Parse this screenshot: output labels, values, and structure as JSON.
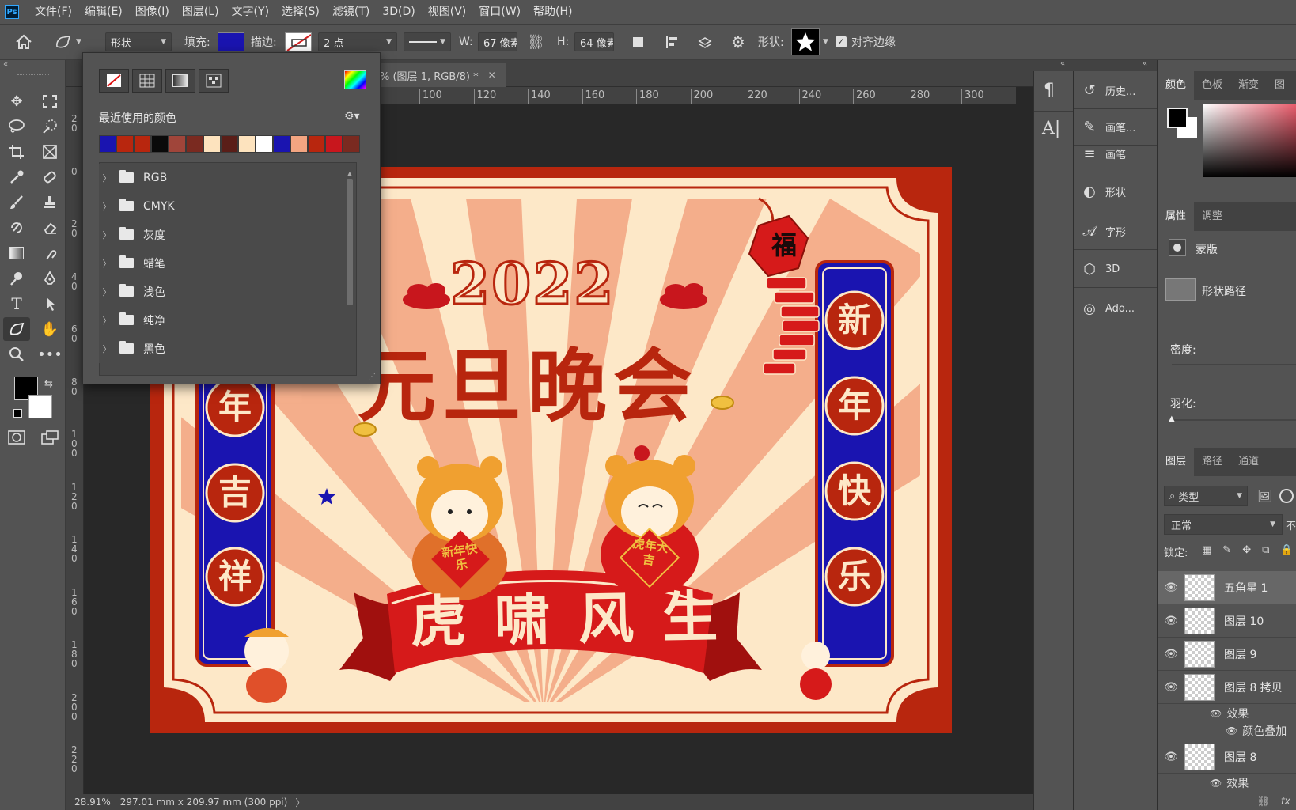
{
  "app": {
    "logo": "Ps"
  },
  "menu": [
    "文件(F)",
    "编辑(E)",
    "图像(I)",
    "图层(L)",
    "文字(Y)",
    "选择(S)",
    "滤镜(T)",
    "3D(D)",
    "视图(V)",
    "窗口(W)",
    "帮助(H)"
  ],
  "options": {
    "mode": "形状",
    "fill_label": "填充:",
    "fill_color": "#1a14b0",
    "stroke_label": "描边:",
    "stroke_width": "2 点",
    "w_label": "W:",
    "w_value": "67 像素",
    "h_label": "H:",
    "h_value": "64 像素",
    "shape_label": "形状:",
    "align_edges": "对齐边缘"
  },
  "document": {
    "tab_title": "% (图层 1, RGB/8) *",
    "zoom": "28.91%",
    "doc_info": "297.01 mm x 209.97 mm (300 ppi)"
  },
  "rulers": {
    "top": [
      "100",
      "120",
      "140",
      "160",
      "180",
      "200",
      "220",
      "240",
      "260",
      "280",
      "300"
    ],
    "left": [
      "2\n0",
      "0",
      "2\n0",
      "4\n0",
      "6\n0",
      "8\n0",
      "1\n0\n0",
      "1\n2\n0",
      "1\n4\n0",
      "1\n6\n0",
      "1\n8\n0",
      "2\n0\n0",
      "2\n2\n0"
    ]
  },
  "swatch_popup": {
    "recent_label": "最近使用的颜色",
    "recent_colors": [
      "#1a14b0",
      "#b8260e",
      "#b8260e",
      "#0a0a0a",
      "#a0453a",
      "#7a2a20",
      "#fde3be",
      "#5a1e18",
      "#fde3be",
      "#ffffff",
      "#1a14b0",
      "#f3a581",
      "#b8260e",
      "#c8161d",
      "#7a2a20"
    ],
    "folders": [
      "RGB",
      "CMYK",
      "灰度",
      "蜡笔",
      "浅色",
      "纯净",
      "黑色"
    ]
  },
  "history_panel": {
    "items": [
      {
        "label": "历史...",
        "icon": "history-icon"
      },
      {
        "label": "画笔...",
        "icon": "brush-settings-icon"
      },
      {
        "label": "画笔",
        "icon": "brushes-icon"
      },
      {
        "label": "形状",
        "icon": "shapes-icon"
      },
      {
        "label": "字形",
        "icon": "glyphs-icon"
      },
      {
        "label": "3D",
        "icon": "3d-icon"
      },
      {
        "label": "Ado...",
        "icon": "adobe-icon"
      }
    ]
  },
  "color_panel": {
    "tabs": [
      "颜色",
      "色板",
      "渐变",
      "图"
    ]
  },
  "properties_panel": {
    "tabs": [
      "属性",
      "调整"
    ],
    "mask_label": "蒙版",
    "shape_path_label": "形状路径",
    "density_label": "密度:",
    "feather_label": "羽化:"
  },
  "layers_panel": {
    "tabs": [
      "图层",
      "路径",
      "通道"
    ],
    "filter_label": "类型",
    "blend_mode": "正常",
    "opacity_label": "不",
    "lock_label": "锁定:",
    "layers": [
      {
        "name": "五角星 1",
        "selected": true
      },
      {
        "name": "图层 10",
        "selected": false
      },
      {
        "name": "图层 9",
        "selected": false
      },
      {
        "name": "图层 8 拷贝",
        "selected": false
      },
      {
        "name": "图层 8",
        "selected": false
      }
    ],
    "effects_label": "效果",
    "color_overlay_label": "颜色叠加",
    "effects_label_2": "效果"
  },
  "artwork": {
    "year": "2022",
    "title": "元旦晚会",
    "banner": "虎啸风生",
    "left_couplet": [
      "年",
      "吉",
      "祥"
    ],
    "right_couplet": [
      "新",
      "年",
      "快",
      "乐"
    ],
    "fu": "福",
    "left_tiger_sign": "新年快乐",
    "right_tiger_sign": "虎年大吉",
    "star_color": "#1a14b0"
  }
}
